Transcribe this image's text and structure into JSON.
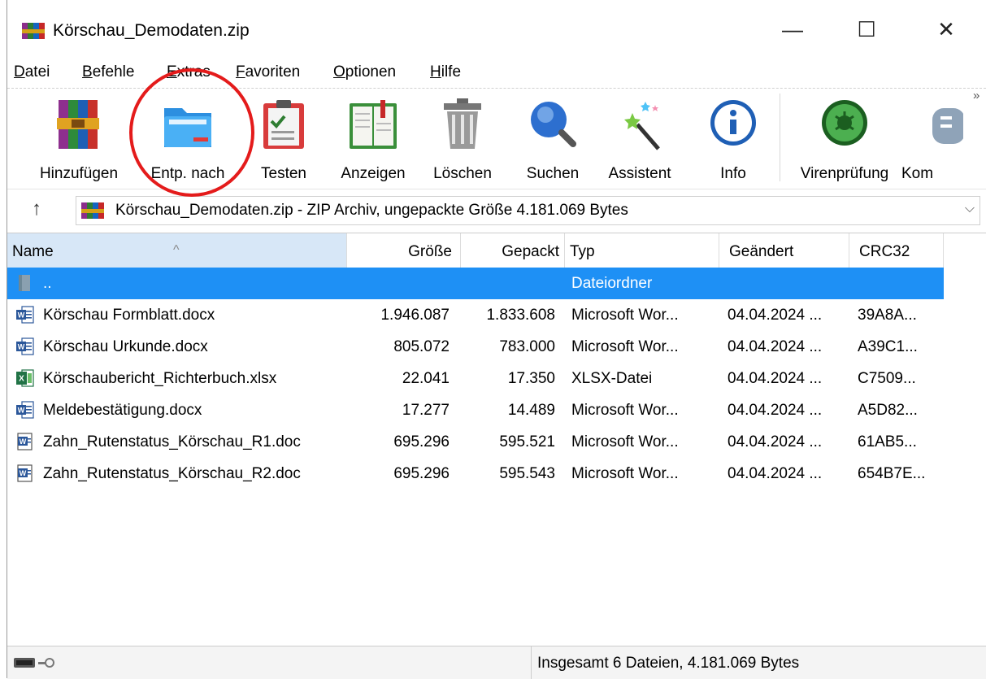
{
  "window": {
    "title": "Körschau_Demodaten.zip",
    "minimize": "—",
    "maximize": "☐",
    "close": "✕"
  },
  "menu": {
    "items": [
      {
        "first": "D",
        "rest": "atei"
      },
      {
        "first": "B",
        "rest": "efehle"
      },
      {
        "first": "E",
        "rest": "xtras"
      },
      {
        "first": "F",
        "rest": "avoriten"
      },
      {
        "first": "O",
        "rest": "ptionen"
      },
      {
        "first": "H",
        "rest": "ilfe"
      }
    ]
  },
  "toolbar": {
    "buttons": [
      {
        "label": "Hinzufügen",
        "icon": "winrar-books-icon"
      },
      {
        "label": "Entp. nach",
        "icon": "folder-extract-icon"
      },
      {
        "label": "Testen",
        "icon": "clipboard-check-icon"
      },
      {
        "label": "Anzeigen",
        "icon": "open-book-icon"
      },
      {
        "label": "Löschen",
        "icon": "trash-can-icon"
      },
      {
        "label": "Suchen",
        "icon": "magnifier-icon"
      },
      {
        "label": "Assistent",
        "icon": "magic-wand-icon"
      },
      {
        "label": "Info",
        "icon": "info-icon"
      },
      {
        "label": "Virenprüfung",
        "icon": "virus-scan-icon"
      },
      {
        "label": "Kom",
        "icon": "comment-icon"
      }
    ],
    "more": "»"
  },
  "address": {
    "up": "↑",
    "text": "Körschau_Demodaten.zip - ZIP Archiv, ungepackte Größe 4.181.069 Bytes",
    "dropdown": "⌵"
  },
  "columns": {
    "name": "Name",
    "size": "Größe",
    "packed": "Gepackt",
    "type": "Typ",
    "modified": "Geändert",
    "crc": "CRC32",
    "sort_indicator": "^"
  },
  "files": [
    {
      "name": "..",
      "size": "",
      "packed": "",
      "type": "Dateiordner",
      "modified": "",
      "crc": "",
      "icon": "folder-icon",
      "selected": true
    },
    {
      "name": "Körschau Formblatt.docx",
      "size": "1.946.087",
      "packed": "1.833.608",
      "type": "Microsoft Wor...",
      "modified": "04.04.2024 ...",
      "crc": "39A8A...",
      "icon": "word-icon"
    },
    {
      "name": "Körschau Urkunde.docx",
      "size": "805.072",
      "packed": "783.000",
      "type": "Microsoft Wor...",
      "modified": "04.04.2024 ...",
      "crc": "A39C1...",
      "icon": "word-icon"
    },
    {
      "name": "Körschaubericht_Richterbuch.xlsx",
      "size": "22.041",
      "packed": "17.350",
      "type": "XLSX-Datei",
      "modified": "04.04.2024 ...",
      "crc": "C7509...",
      "icon": "excel-icon"
    },
    {
      "name": "Meldebestätigung.docx",
      "size": "17.277",
      "packed": "14.489",
      "type": "Microsoft Wor...",
      "modified": "04.04.2024 ...",
      "crc": "A5D82...",
      "icon": "word-icon"
    },
    {
      "name": "Zahn_Rutenstatus_Körschau_R1.doc",
      "size": "695.296",
      "packed": "595.521",
      "type": "Microsoft Wor...",
      "modified": "04.04.2024 ...",
      "crc": "61AB5...",
      "icon": "word-old-icon"
    },
    {
      "name": "Zahn_Rutenstatus_Körschau_R2.doc",
      "size": "695.296",
      "packed": "595.543",
      "type": "Microsoft Wor...",
      "modified": "04.04.2024 ...",
      "crc": "654B7E...",
      "icon": "word-old-icon"
    }
  ],
  "status": {
    "text": "Insgesamt 6 Dateien, 4.181.069 Bytes"
  },
  "colors": {
    "selection": "#1e90f5",
    "highlight_circle": "#e41b1b"
  }
}
